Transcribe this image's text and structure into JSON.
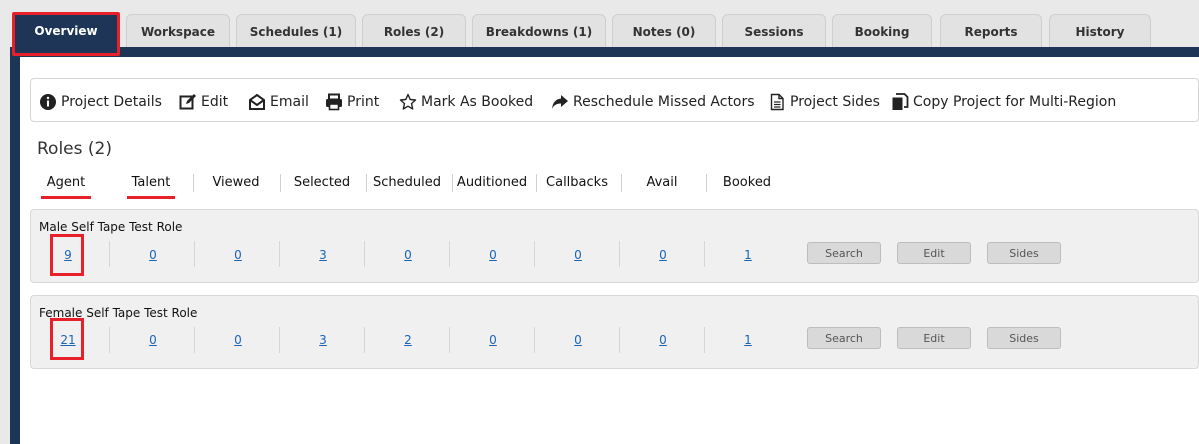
{
  "tabs": [
    {
      "label": "Overview"
    },
    {
      "label": "Workspace"
    },
    {
      "label": "Schedules (1)"
    },
    {
      "label": "Roles (2)"
    },
    {
      "label": "Breakdowns (1)"
    },
    {
      "label": "Notes (0)"
    },
    {
      "label": "Sessions"
    },
    {
      "label": "Booking"
    },
    {
      "label": "Reports"
    },
    {
      "label": "History"
    }
  ],
  "toolbar": {
    "project_details": "Project Details",
    "edit": "Edit",
    "email": "Email",
    "print": "Print",
    "mark_as_booked": "Mark As Booked",
    "reschedule": "Reschedule Missed Actors",
    "project_sides": "Project Sides",
    "copy_project": "Copy Project for Multi-Region"
  },
  "roles": {
    "title": "Roles (2)",
    "columns": [
      "Agent",
      "Talent",
      "Viewed",
      "Selected",
      "Scheduled",
      "Auditioned",
      "Callbacks",
      "Avail",
      "Booked"
    ],
    "items": [
      {
        "name": "Male Self Tape Test Role",
        "counts": [
          "9",
          "0",
          "0",
          "3",
          "0",
          "0",
          "0",
          "0",
          "1"
        ]
      },
      {
        "name": "Female Self Tape Test Role",
        "counts": [
          "21",
          "0",
          "0",
          "3",
          "2",
          "0",
          "0",
          "0",
          "1"
        ]
      }
    ],
    "buttons": {
      "search": "Search",
      "edit": "Edit",
      "sides": "Sides"
    }
  },
  "colors": {
    "navy": "#1f3557",
    "highlight": "#e8202a",
    "link": "#1a64b5"
  }
}
